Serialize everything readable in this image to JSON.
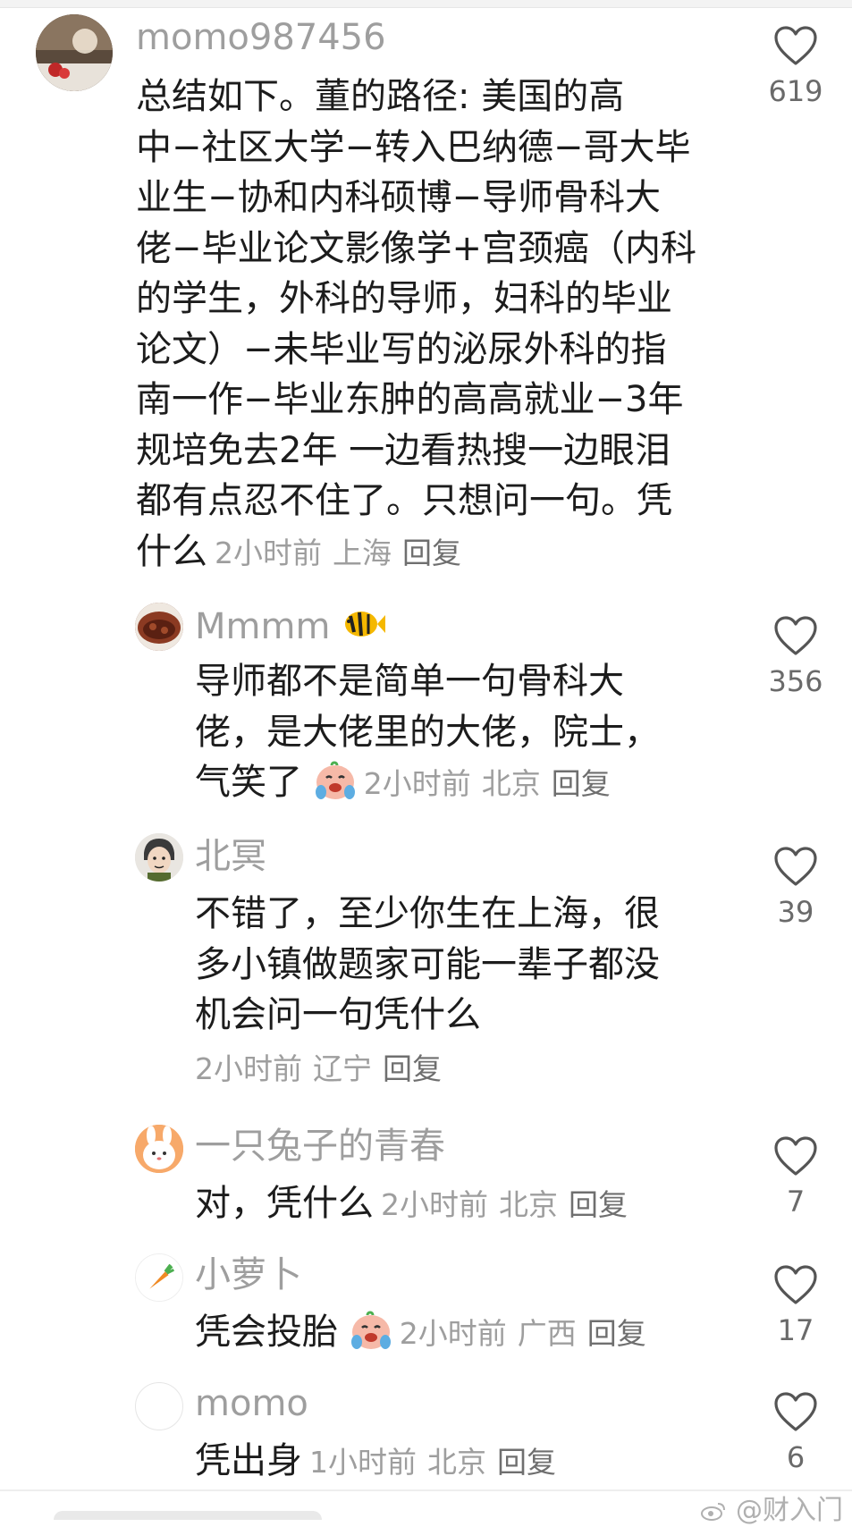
{
  "comments": [
    {
      "username": "momo987456",
      "text_lines": [
        "总结如下。董的路径: 美国的高",
        "中−社区大学−转入巴纳德−哥大毕",
        "业生−协和内科硕博−导师骨科大",
        "佬−毕业论文影像学+宫颈癌（内科",
        "的学生，外科的导师，妇科的毕业",
        "论文）−未毕业写的泌尿外科的指",
        "南一作−毕业东肿的高高就业−3年",
        "规培免去2年  一边看热搜一边眼泪",
        "都有点忍不住了。只想问一句。凭"
      ],
      "last_line": "什么",
      "time": "2小时前",
      "location": "上海",
      "reply_label": "回复",
      "likes": "619"
    },
    {
      "username": "Mmmm",
      "text_lines": [
        "导师都不是简单一句骨科大",
        "佬，是大佬里的大佬，院士，"
      ],
      "last_line": "气笑了",
      "time": "2小时前",
      "location": "北京",
      "reply_label": "回复",
      "likes": "356"
    },
    {
      "username": "北冥",
      "text_lines": [
        "不错了，至少你生在上海，很",
        "多小镇做题家可能一辈子都没",
        "机会问一句凭什么"
      ],
      "time": "2小时前",
      "location": "辽宁",
      "reply_label": "回复",
      "likes": "39"
    },
    {
      "username": "一只兔子的青春",
      "last_line": "对，凭什么",
      "time": "2小时前",
      "location": "北京",
      "reply_label": "回复",
      "likes": "7"
    },
    {
      "username": "小萝卜",
      "last_line": "凭会投胎",
      "time": "2小时前",
      "location": "广西",
      "reply_label": "回复",
      "likes": "17"
    },
    {
      "username": "momo",
      "last_line": "凭出身",
      "time": "1小时前",
      "location": "北京",
      "reply_label": "回复",
      "likes": "6"
    }
  ],
  "watermark": "@财入门",
  "icons": {
    "like": "heart-outline-icon",
    "emoji": "crying-laugh-emoji",
    "username_badge": "tropical-fish-emoji"
  },
  "colors": {
    "text": "#1c1c1c",
    "meta": "#9e9e9e",
    "username": "#9e9e9e"
  }
}
